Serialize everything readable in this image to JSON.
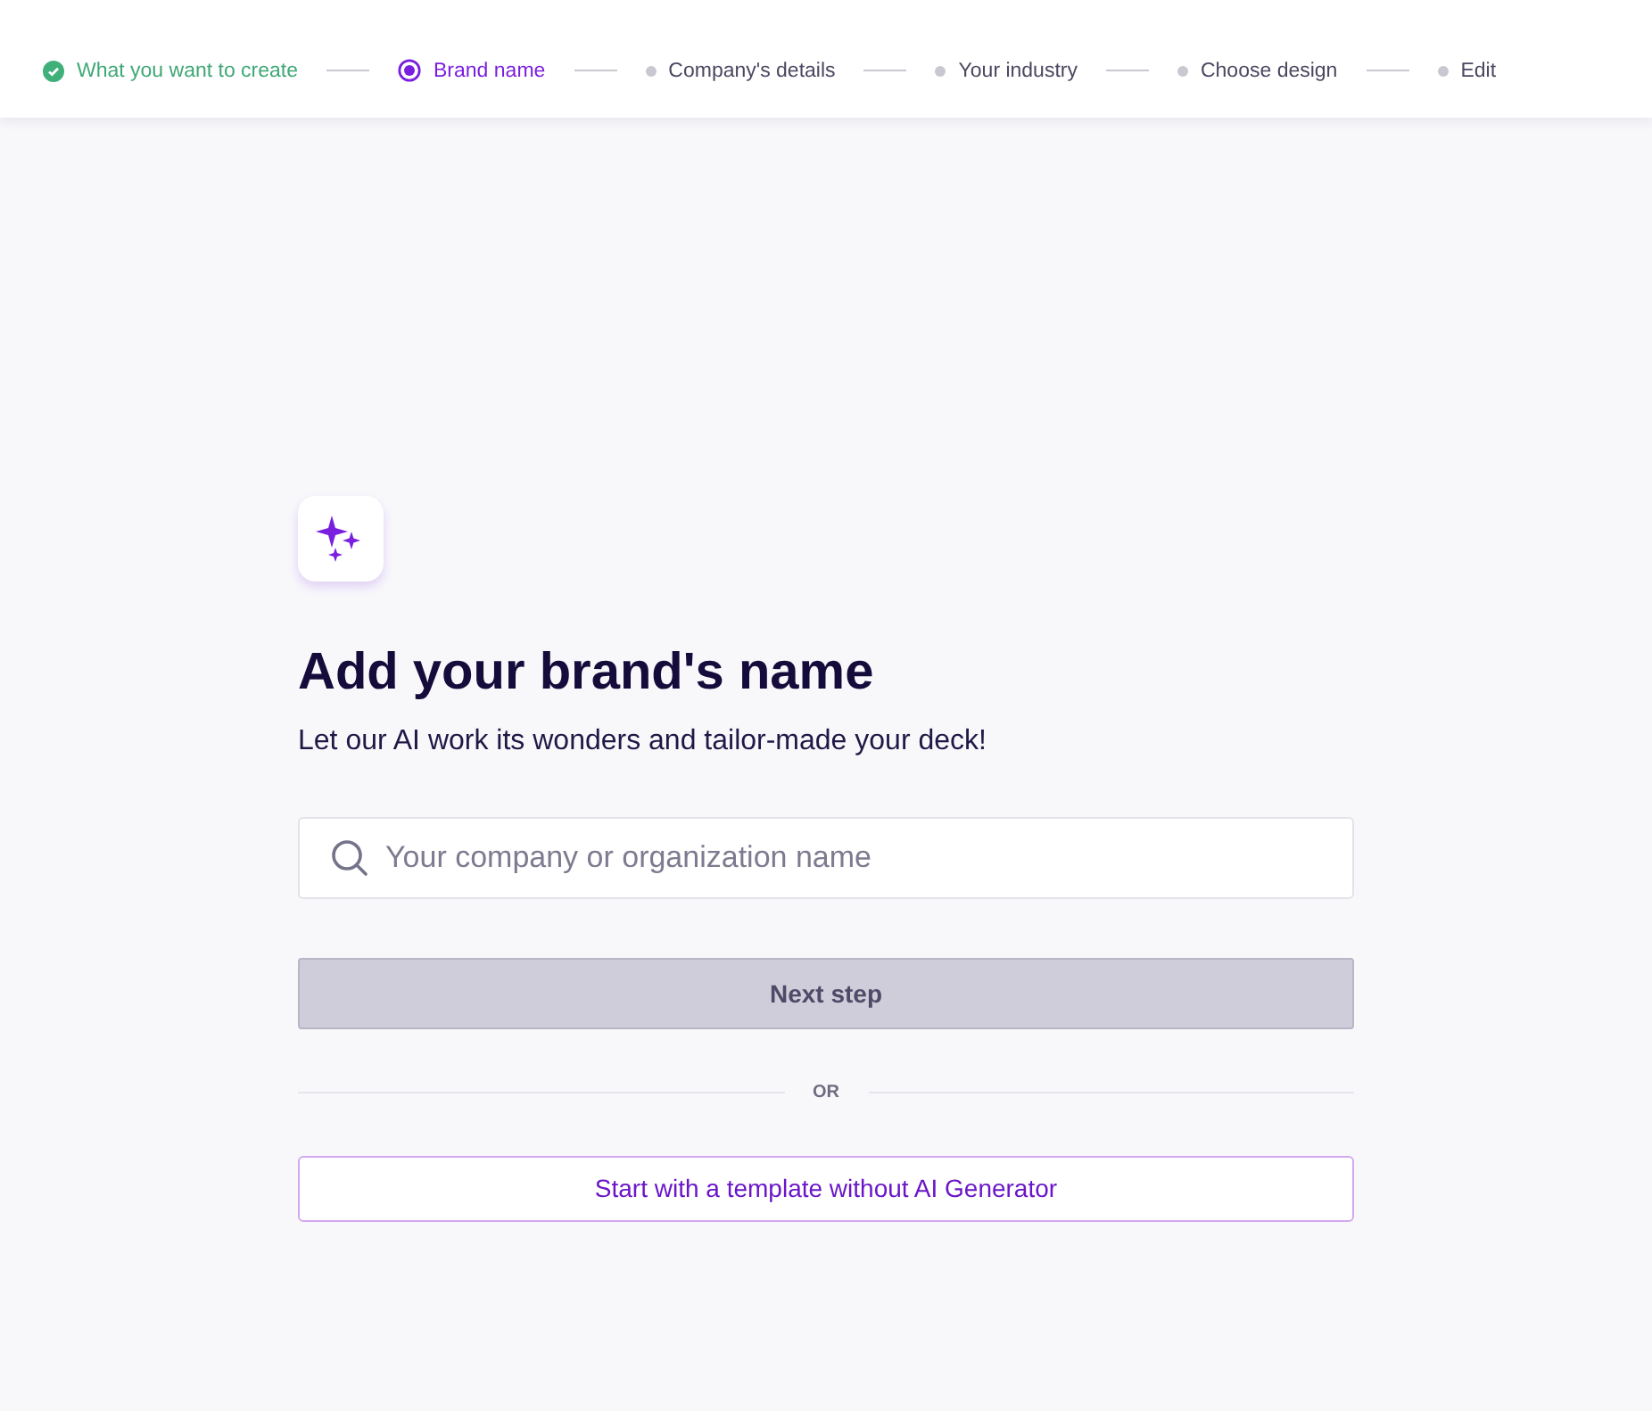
{
  "steps": [
    {
      "label": "What you want to create",
      "kind": "done"
    },
    {
      "label": "Brand name",
      "kind": "current"
    },
    {
      "label": "Company's details",
      "kind": "pending"
    },
    {
      "label": "Your industry",
      "kind": "pending"
    },
    {
      "label": "Choose design",
      "kind": "pending"
    },
    {
      "label": "Edit",
      "kind": "pending"
    }
  ],
  "title": "Add your brand's name",
  "subtitle": "Let our AI work its wonders and tailor-made your deck!",
  "name_field": {
    "placeholder": "Your company or organization name"
  },
  "next_button": {
    "label": "Next step",
    "disabled": true
  },
  "divider_label": "OR",
  "template_button": {
    "label": "Start with a template without AI Generator"
  }
}
